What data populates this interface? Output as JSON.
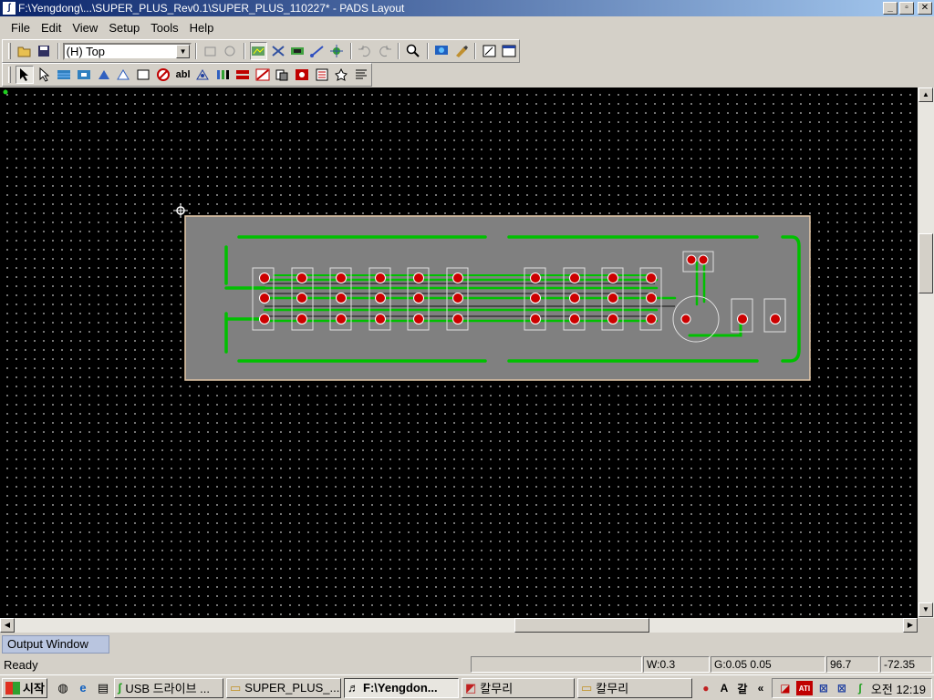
{
  "window": {
    "title": "F:\\Yengdong\\...\\SUPER_PLUS_Rev0.1\\SUPER_PLUS_110227* - PADS Layout",
    "icon": "pads-icon",
    "buttons": {
      "minimize": "_",
      "maximize": "▫",
      "close": "✕"
    }
  },
  "menu": [
    {
      "label": "File",
      "key": "F"
    },
    {
      "label": "Edit",
      "key": "E"
    },
    {
      "label": "View",
      "key": "V"
    },
    {
      "label": "Setup",
      "key": "S"
    },
    {
      "label": "Tools",
      "key": "T"
    },
    {
      "label": "Help",
      "key": "H"
    }
  ],
  "toolbar": {
    "layer_select": "(H) Top"
  },
  "output_window": {
    "label": "Output Window"
  },
  "status": {
    "ready": "Ready",
    "width": "W:0.3",
    "grid": "G:0.05 0.05",
    "x": "96.7",
    "y": "-72.35"
  },
  "taskbar": {
    "start": "시작",
    "tasks": [
      {
        "label": "USB 드라이브 ...",
        "icon": "usb-icon"
      },
      {
        "label": "SUPER_PLUS_...",
        "icon": "folder-icon"
      },
      {
        "label": "F:\\Yengdon...",
        "icon": "pads-icon",
        "active": true
      },
      {
        "label": "칼무리",
        "icon": "app-icon"
      },
      {
        "label": "칼무리",
        "icon": "folder-icon"
      }
    ],
    "clock": "오전 12:19"
  },
  "colors": {
    "title_gradient_start": "#0a246a",
    "board_fill": "#808080",
    "board_outline": "#e6c9a8",
    "trace": "#00c000",
    "pad": "#cc0000"
  }
}
